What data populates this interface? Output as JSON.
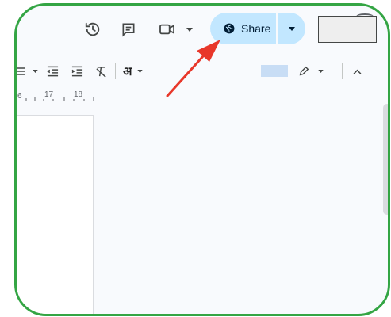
{
  "header": {
    "share_label": "Share",
    "icons": {
      "history": "version-history-icon",
      "comments": "comments-icon",
      "meet": "meet-video-icon",
      "share_globe": "globe-icon",
      "share_caret": "caret-down-icon"
    }
  },
  "toolbar": {
    "language_glyph": "अ",
    "icons": [
      "bullet-list-icon",
      "decrease-indent-icon",
      "increase-indent-icon",
      "clear-formatting-icon",
      "input-tools-icon",
      "pen-icon",
      "collapse-chevron-icon"
    ]
  },
  "ruler": {
    "tick_labels": [
      "6",
      "17",
      "18"
    ]
  },
  "colors": {
    "frame_border": "#34a544",
    "share_background": "#c2e7ff",
    "arrow": "#e8372a",
    "workspace": "#f8fafd"
  }
}
